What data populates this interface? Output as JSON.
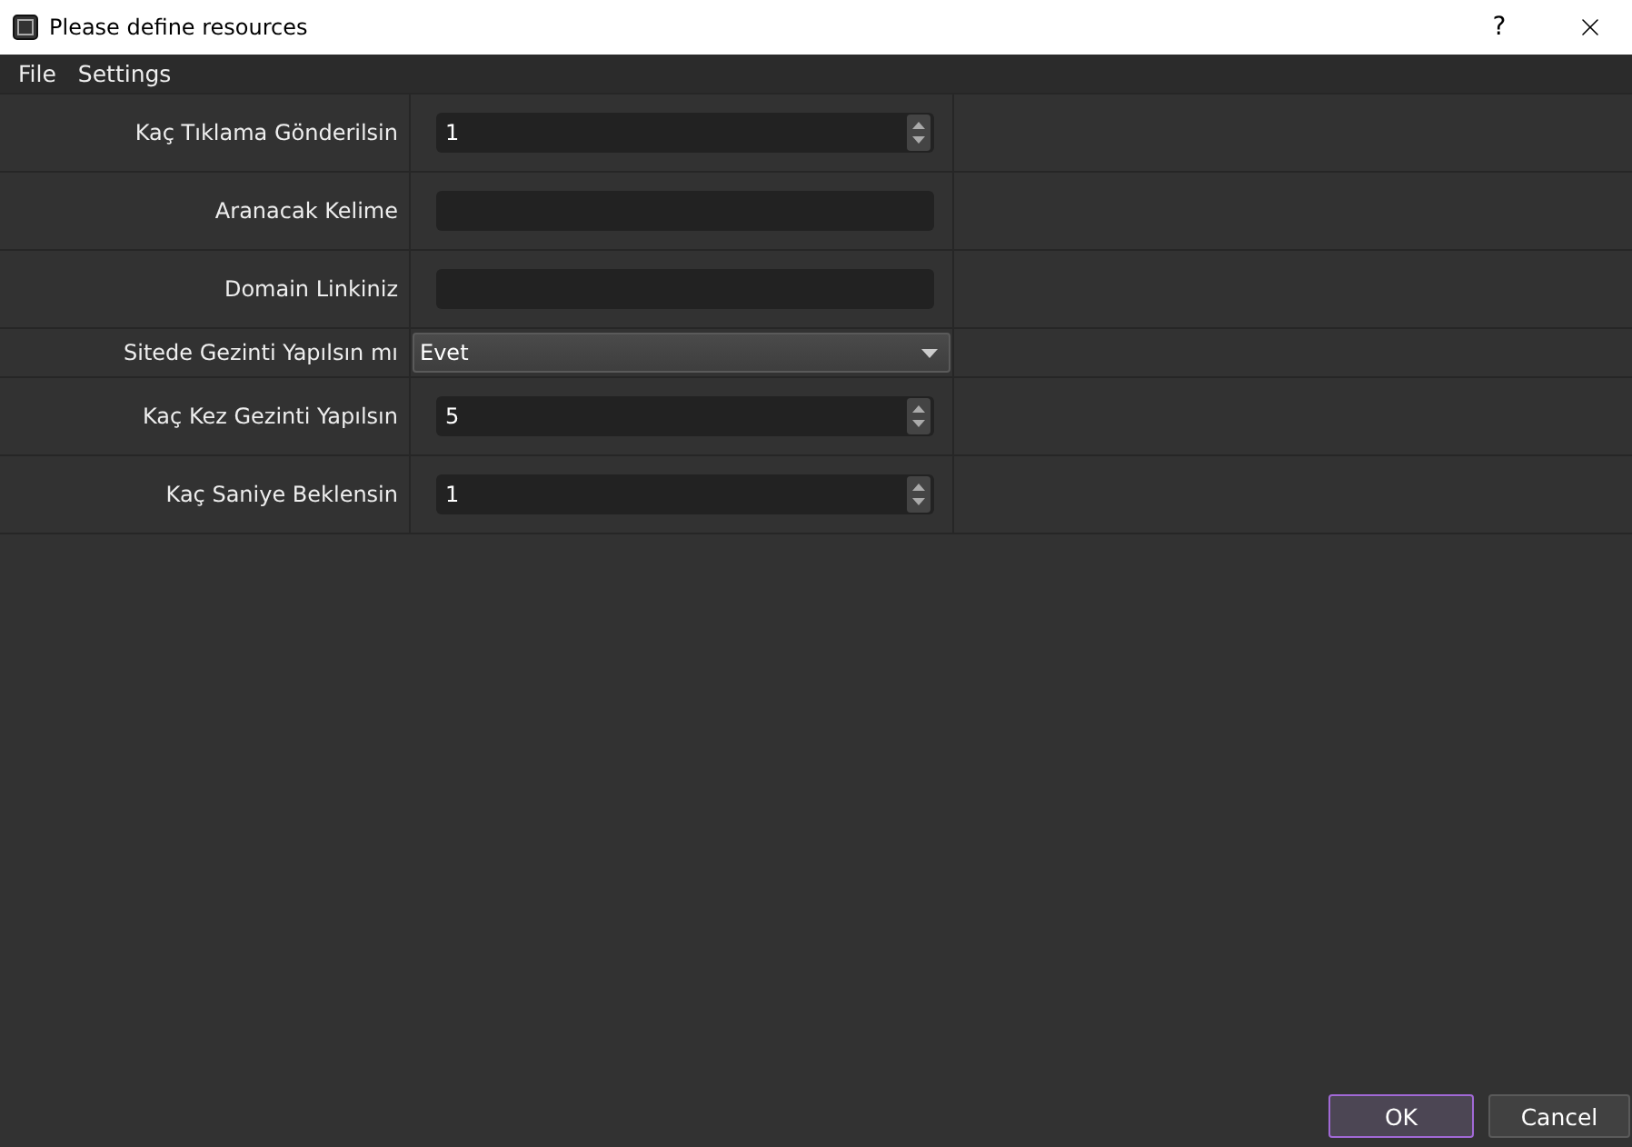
{
  "window": {
    "title": "Please define resources",
    "help": "?"
  },
  "menu": [
    "File",
    "Settings"
  ],
  "fields": [
    {
      "label": "Kaç Tıklama Gönderilsin",
      "kind": "spin",
      "value": "1"
    },
    {
      "label": "Aranacak Kelime",
      "kind": "text"
    },
    {
      "label": "Domain Linkiniz",
      "kind": "text"
    },
    {
      "label": "Sitede Gezinti Yapılsın mı",
      "kind": "select",
      "value": "Evet"
    },
    {
      "label": "Kaç Kez Gezinti Yapılsın",
      "kind": "spin",
      "value": "5"
    },
    {
      "label": "Kaç Saniye Beklensin",
      "kind": "spin",
      "value": "1"
    }
  ],
  "buttons": [
    {
      "label": "OK",
      "default": true
    },
    {
      "label": "Cancel",
      "default": false
    }
  ]
}
